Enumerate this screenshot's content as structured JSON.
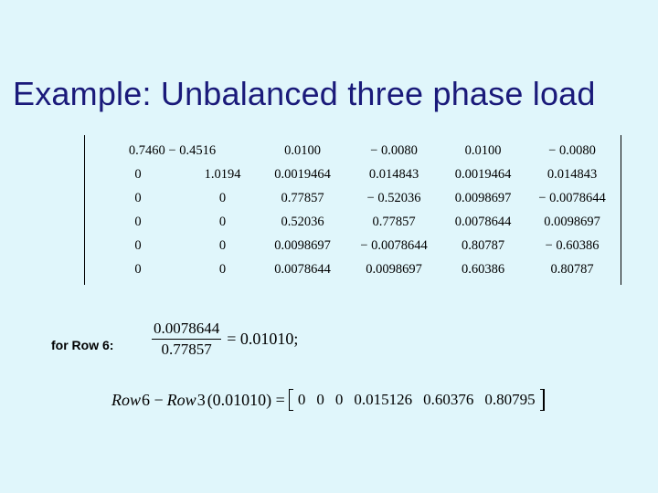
{
  "title": "Example: Unbalanced three phase load",
  "matrix": {
    "rows": [
      [
        "0.7460 − 0.4516",
        "0.0100",
        "− 0.0080",
        "0.0100",
        "− 0.0080"
      ],
      [
        "0",
        "1.0194",
        "0.0019464",
        "0.014843",
        "0.0019464",
        "0.014843"
      ],
      [
        "0",
        "0",
        "0.77857",
        "− 0.52036",
        "0.0098697",
        "− 0.0078644"
      ],
      [
        "0",
        "0",
        "0.52036",
        "0.77857",
        "0.0078644",
        "0.0098697"
      ],
      [
        "0",
        "0",
        "0.0098697",
        "− 0.0078644",
        "0.80787",
        "− 0.60386"
      ],
      [
        "0",
        "0",
        "0.0078644",
        "0.0098697",
        "0.60386",
        "0.80787"
      ]
    ]
  },
  "row6": {
    "label": "for Row 6:",
    "frac_num": "0.0078644",
    "frac_den": "0.77857",
    "eq_result": "= 0.01010;"
  },
  "expr": {
    "lhs_a": "Row",
    "lhs_a2": "6 −",
    "lhs_b": "Row",
    "lhs_b2": "3",
    "factor": "(0.01010) =",
    "vec": [
      "0",
      "0",
      "0",
      "0.015126",
      "0.60376",
      "0.80795"
    ]
  }
}
